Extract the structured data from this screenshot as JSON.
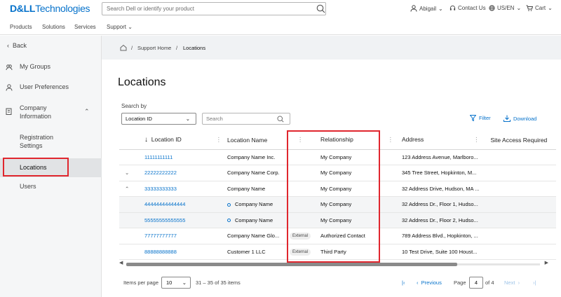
{
  "header": {
    "logo_bold": "D&LL",
    "logo_rest": "Technologies",
    "search_placeholder": "Search Dell or identify your product",
    "user": "Abigail",
    "contact": "Contact Us",
    "locale": "US/EN",
    "cart": "Cart"
  },
  "nav": [
    "Products",
    "Solutions",
    "Services",
    "Support"
  ],
  "sidebar": {
    "back": "Back",
    "items": [
      {
        "label": "My Groups"
      },
      {
        "label": "User Preferences"
      },
      {
        "label": "Company Information"
      },
      {
        "label": "Registration Settings"
      },
      {
        "label": "Locations"
      },
      {
        "label": "Users"
      }
    ]
  },
  "breadcrumb": {
    "home": "Support Home",
    "sep": "/",
    "current": "Locations"
  },
  "page": {
    "title": "Locations",
    "search_by": "Search by",
    "select_value": "Location ID",
    "search_placeholder": "Search",
    "filter": "Filter",
    "download": "Download"
  },
  "table": {
    "columns": [
      "Location ID",
      "Location Name",
      "Relationship",
      "Address",
      "Site Access Required"
    ],
    "rows": [
      {
        "id": "11111111111",
        "name": "Company Name Inc.",
        "badge": "",
        "rel": "My Company",
        "addr": "123 Address Avenue, Marlboro..."
      },
      {
        "id": "22222222222",
        "name": "Company Name Corp.",
        "badge": "",
        "rel": "My Company",
        "addr": "345 Tree Street, Hopkinton, M..."
      },
      {
        "id": "33333333333",
        "name": "Company Name",
        "badge": "",
        "rel": "My Company",
        "addr": "32 Address Drive, Hudson, MA ..."
      },
      {
        "id": "44444444444444",
        "name": "Company Name",
        "badge": "",
        "rel": "My Company",
        "addr": "32 Address Dr., Floor 1, Hudso..."
      },
      {
        "id": "55555555555555",
        "name": "Company Name",
        "badge": "",
        "rel": "My Company",
        "addr": "32 Address Dr., Floor 2, Hudso..."
      },
      {
        "id": "77777777777",
        "name": "Company Name Glo...",
        "badge": "External",
        "rel": "Authorized Contact",
        "addr": "789 Address Blvd., Hopkinton, ..."
      },
      {
        "id": "88888888888",
        "name": "Customer 1 LLC",
        "badge": "External",
        "rel": "Third Party",
        "addr": "10 Test Drive, Suite 100 Houst..."
      }
    ]
  },
  "pager": {
    "items_per_page": "Items per page",
    "page_size": "10",
    "range": "31 – 35 of 35 items",
    "previous": "Previous",
    "page_label": "Page",
    "page": "4",
    "of": "of 4",
    "next": "Next"
  }
}
